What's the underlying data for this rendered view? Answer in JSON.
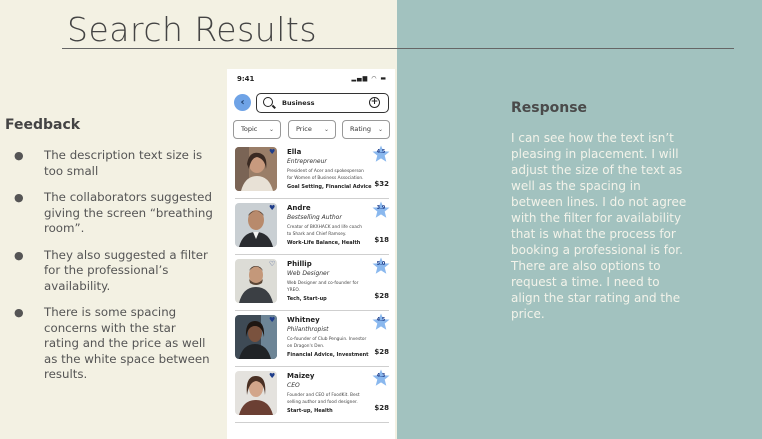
{
  "slide": {
    "title": "Search Results"
  },
  "feedback": {
    "heading": "Feedback",
    "items": [
      "The description text size is too small",
      "The collaborators suggested giving the screen “breathing room”.",
      "They also suggested a filter for the professional’s availability.",
      "There is some spacing concerns with the star rating and the price as well as the white space between results."
    ]
  },
  "response": {
    "heading": "Response",
    "text": "I can see how the text isn’t pleasing in placement. I will adjust the size of the text as well as the spacing in between lines. I do not agree with the filter for availability that is what the process for booking a professional is for. There are also options to request a time. I need to align the star rating and the price."
  },
  "phone": {
    "status_time": "9:41",
    "status_icons": "▂▄▆ ◠ ▬",
    "back_icon": "‹",
    "search_value": "Business",
    "add_icon": "+",
    "filters": [
      {
        "label": "Topic",
        "chevron": "⌄"
      },
      {
        "label": "Price",
        "chevron": "⌄"
      },
      {
        "label": "Rating",
        "chevron": "⌄"
      }
    ],
    "results": [
      {
        "name": "Ella",
        "role": "Entrepreneur",
        "desc": "President of Acer and spokesperson for Women of Business Association.",
        "tags": "Goal Setting, Financial Advice",
        "price": "$32",
        "rating": "4.5",
        "favorited": true,
        "heart": "♥"
      },
      {
        "name": "Andre",
        "role": "Bestselling Author",
        "desc": "Creator of BKXHACK and life coach to Shark and Chief Ramsey.",
        "tags": "Work-Life Balance, Health",
        "price": "$18",
        "rating": "3.9",
        "favorited": true,
        "heart": "♥"
      },
      {
        "name": "Phillip",
        "role": "Web Designer",
        "desc": "Web Designer and co-founder for YREO.",
        "tags": "Tech, Start-up",
        "price": "$28",
        "rating": "5.0",
        "favorited": false,
        "heart": "♡"
      },
      {
        "name": "Whitney",
        "role": "Philanthropist",
        "desc": "Co-founder of Club Penguin. Investor on Dragon's Den.",
        "tags": "Financial Advice, Investment",
        "price": "$28",
        "rating": "4.5",
        "favorited": true,
        "heart": "♥"
      },
      {
        "name": "Maizey",
        "role": "CEO",
        "desc": "Founder and CEO of FoodKit. Best selling author and food designer.",
        "tags": "Start-up, Health",
        "price": "$28",
        "rating": "4.3",
        "favorited": true,
        "heart": "♥"
      }
    ]
  }
}
